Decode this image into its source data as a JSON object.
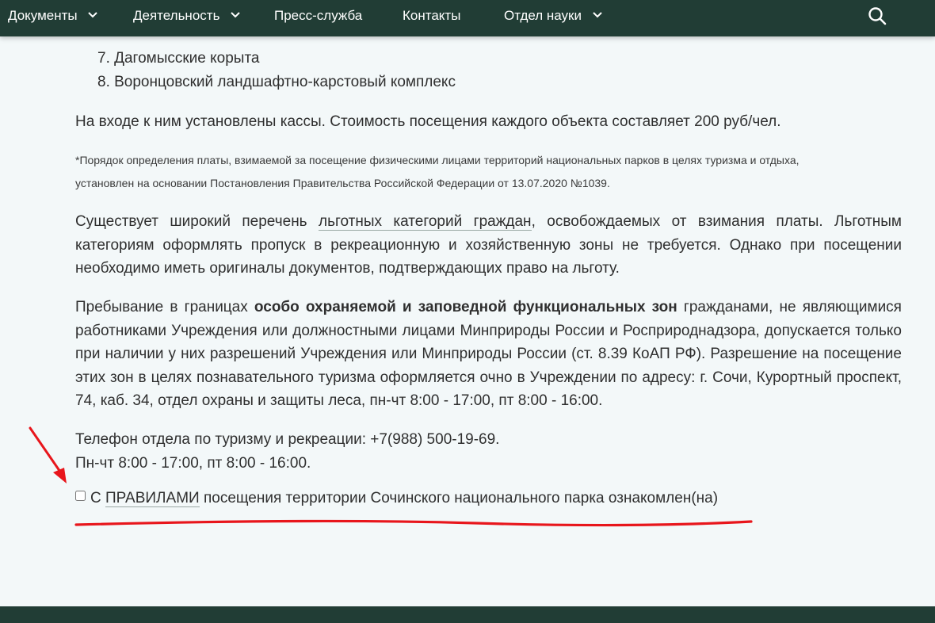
{
  "nav": {
    "items": [
      {
        "label": "Документы",
        "has_dropdown": true
      },
      {
        "label": "Деятельность",
        "has_dropdown": true
      },
      {
        "label": "Пресс-служба",
        "has_dropdown": false
      },
      {
        "label": "Контакты",
        "has_dropdown": false
      },
      {
        "label": "Отдел науки",
        "has_dropdown": true
      }
    ],
    "search_icon": "search-icon"
  },
  "content": {
    "list_items": [
      {
        "label": "7. Дагомысские корыта"
      },
      {
        "label": "8. Воронцовский ландшафтно-карстовый комплекс"
      }
    ],
    "cashier_text": "На входе к ним установлены кассы. Стоимость посещения каждого объекта составляет 200 руб/чел.",
    "note_line1": "*Порядок определения платы, взимаемой за посещение физическими лицами территорий национальных парков в целях туризма и отдыха,",
    "note_line2": "установлен на основании Постановления Правительства Российской Федерации от 13.07.2020 №1039.",
    "benefits": {
      "before": "Существует широкий перечень ",
      "link": "льготных категорий граждан",
      "after": ", освобождаемых от взимания платы. Льготным категориям оформлять пропуск в рекреационную и хозяйственную зоны не требуется. Однако при посещении необходимо иметь оригиналы документов, подтверждающих право на льготу."
    },
    "protected": {
      "before": "Пребывание в границах ",
      "bold": "особо охраняемой и заповедной функциональных зон",
      "after": " гражданами, не являющимися работниками Учреждения или должностными лицами Минприроды России и Росприроднадзора, допускается только при наличии у них разрешений Учреждения или Минприроды России (ст. 8.39 КоАП РФ). Разрешение на посещение этих зон в целях познавательного туризма оформляется очно в Учреждении по адресу: г. Сочи, Курортный проспект, 74, каб. 34, отдел охраны и защиты леса, пн-чт 8:00 - 17:00, пт 8:00 - 16:00."
    },
    "phone_line": "Телефон отдела по туризму и рекреации: +7(988) 500-19-69.",
    "hours_line": "Пн-чт 8:00 - 17:00, пт 8:00 - 16:00."
  },
  "agreement": {
    "checked": false,
    "before": "С ",
    "link": "ПРАВИЛАМИ",
    "after": " посещения территории Сочинского национального парка ознакомлен(на)"
  },
  "colors": {
    "nav_bg": "#213d35",
    "page_bg": "#f3f8f9",
    "annotation": "#e8161c"
  }
}
